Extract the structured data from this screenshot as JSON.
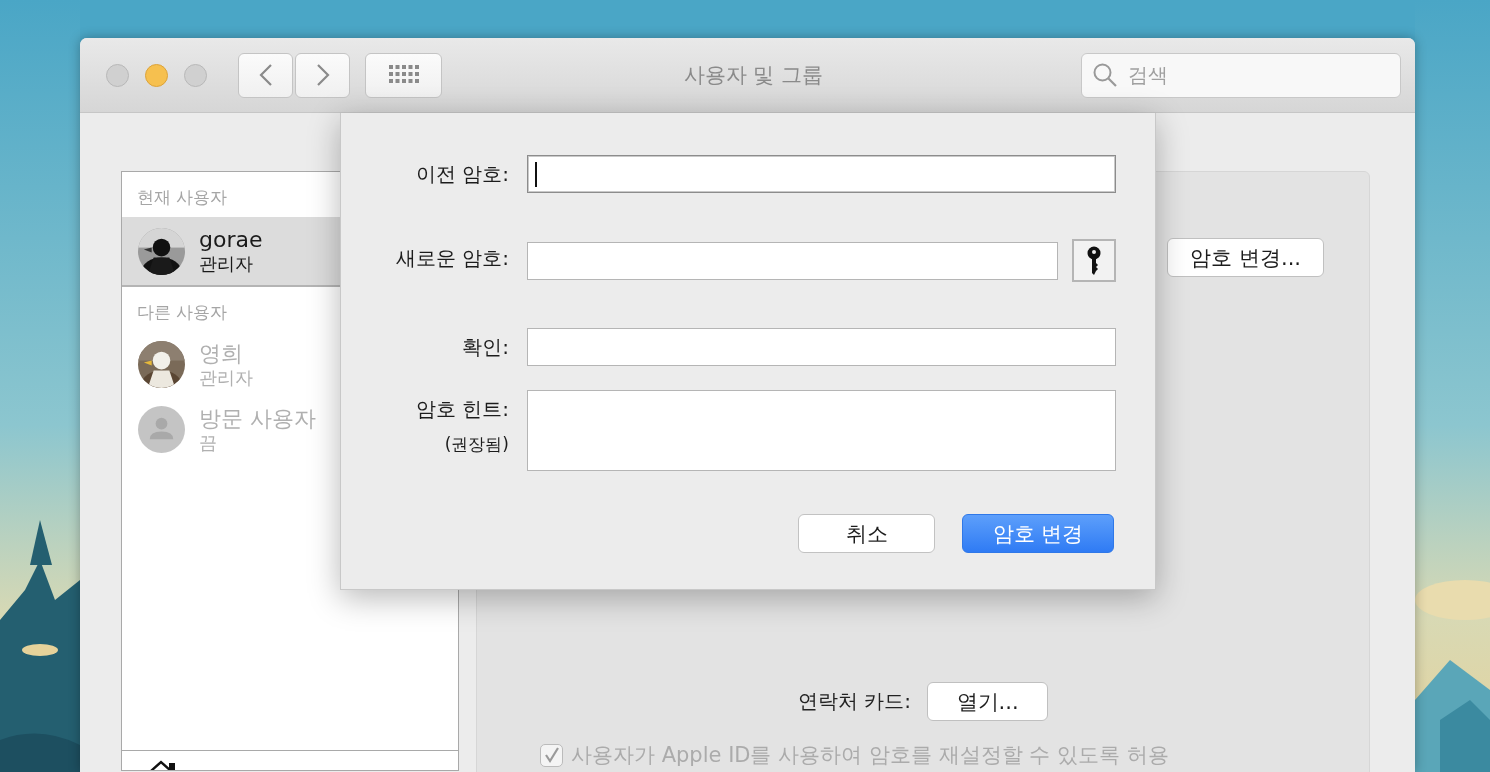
{
  "window": {
    "title": "사용자 및 그룹"
  },
  "search": {
    "placeholder": "검색"
  },
  "sidebar": {
    "sections": [
      {
        "header": "현재 사용자",
        "users": [
          {
            "name": "gorae",
            "role": "관리자",
            "selected": true,
            "disabled": false,
            "kind": "picture"
          }
        ]
      },
      {
        "header": "다른 사용자",
        "users": [
          {
            "name": "영희",
            "role": "관리자",
            "selected": false,
            "disabled": true,
            "kind": "picture"
          },
          {
            "name": "방문 사용자",
            "role": "끔",
            "selected": false,
            "disabled": true,
            "kind": "silhouette"
          }
        ]
      }
    ]
  },
  "panel": {
    "change_password_button": "암호 변경...",
    "contact_card_label": "연락처 카드:",
    "open_button": "열기...",
    "apple_id_option": {
      "label": "사용자가 Apple ID를 사용하여 암호를 재설정할 수 있도록 허용",
      "checked": true,
      "disabled": true
    }
  },
  "sheet": {
    "fields": [
      {
        "label": "이전 암호:",
        "kind": "password",
        "focused": true
      },
      {
        "label": "새로운 암호:",
        "kind": "password_with_key",
        "focused": false
      },
      {
        "label": "확인:",
        "kind": "password",
        "focused": false
      },
      {
        "label": "암호 힌트:",
        "sublabel": "(권장됨)",
        "kind": "textarea",
        "focused": false
      }
    ],
    "buttons": [
      {
        "label": "취소",
        "default": false
      },
      {
        "label": "암호 변경",
        "default": true
      }
    ]
  }
}
